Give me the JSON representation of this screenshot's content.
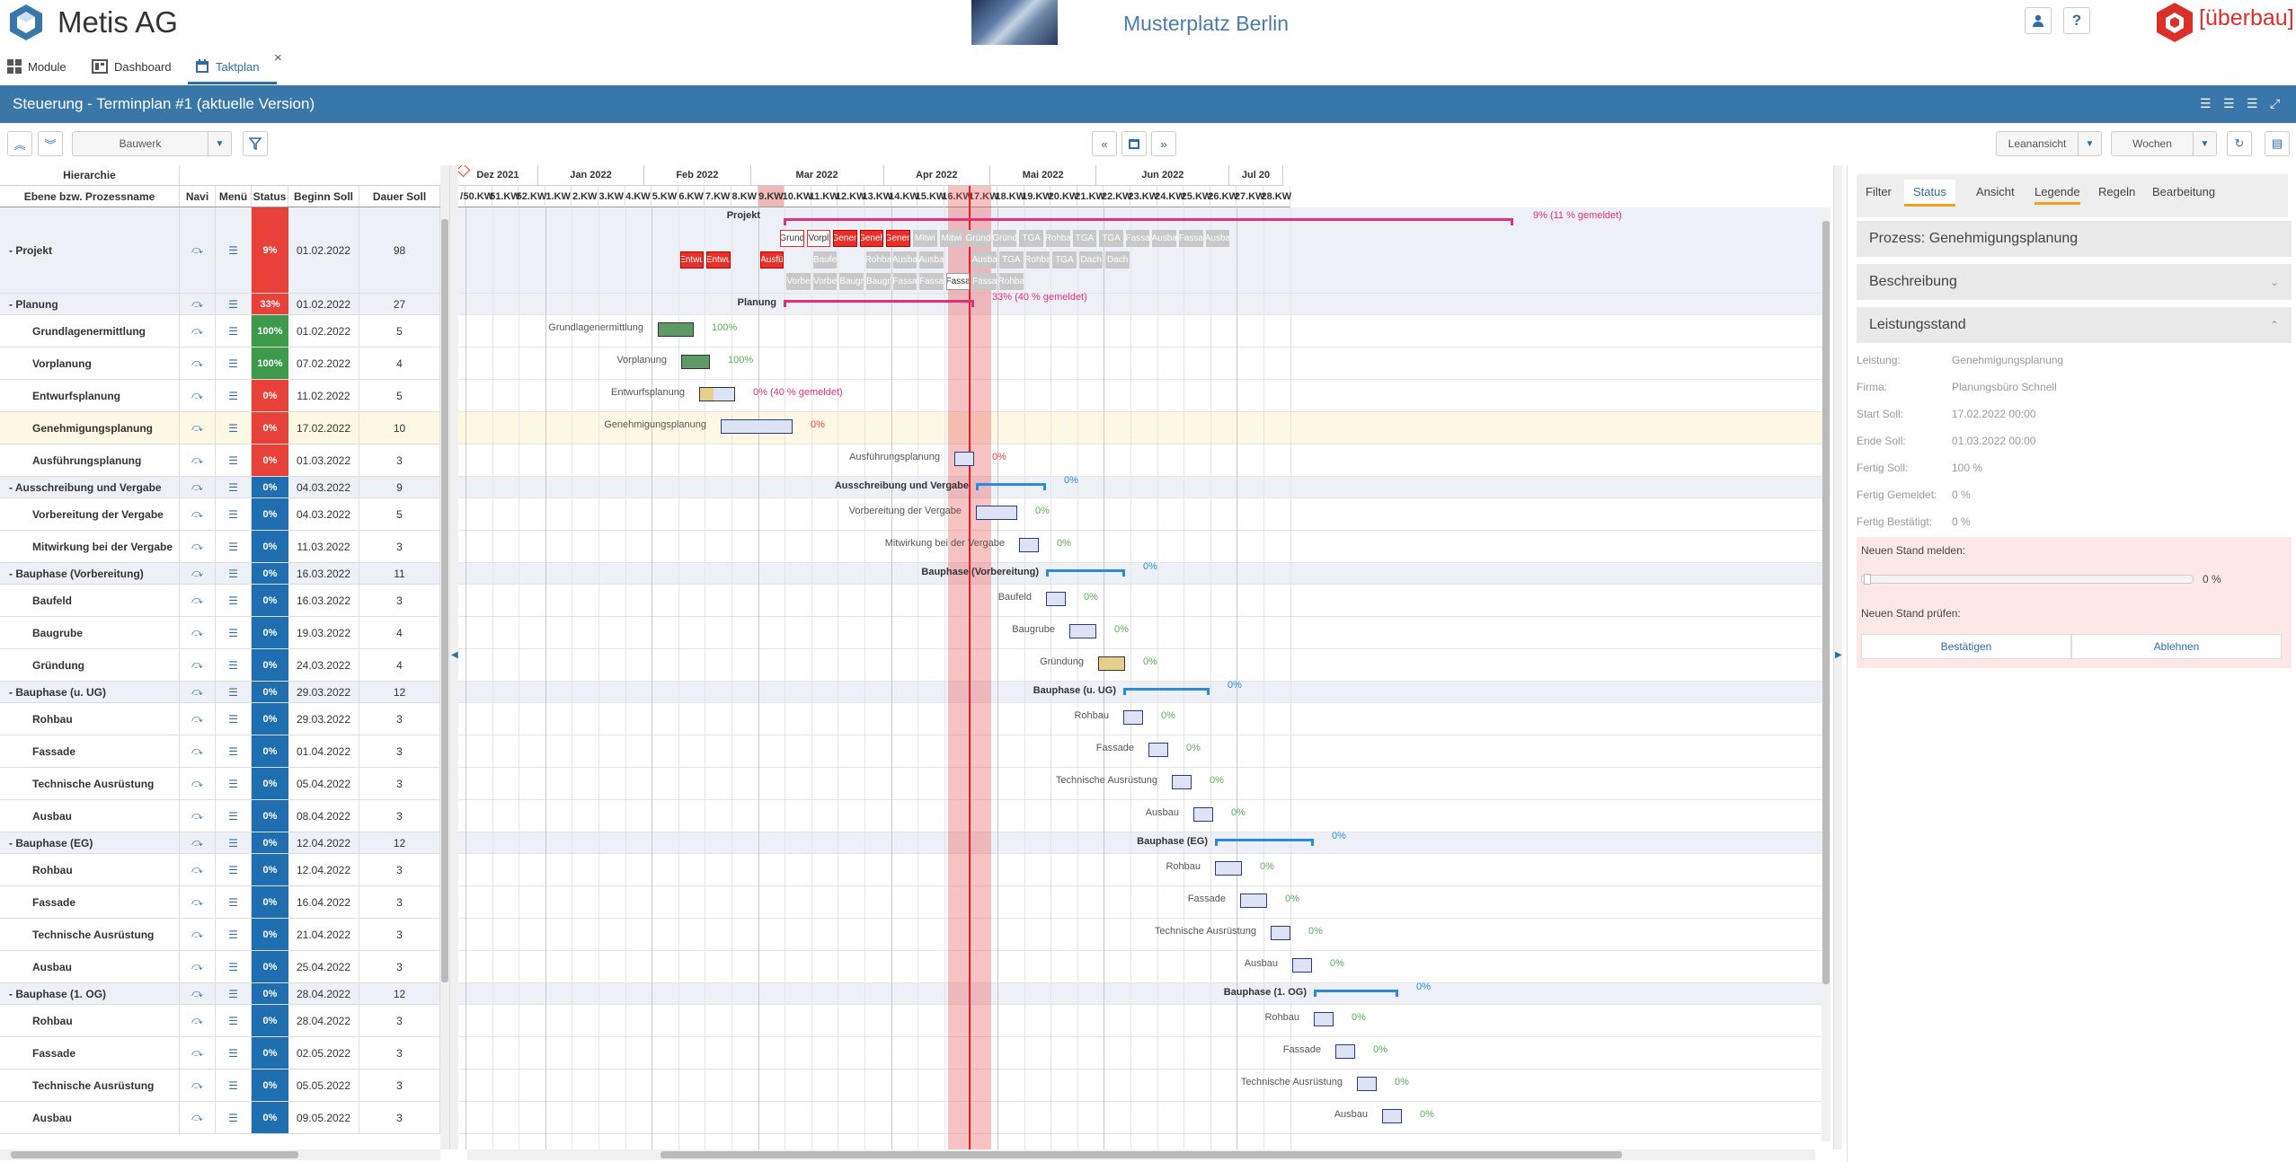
{
  "app": {
    "title": "Metis AG",
    "project": "Musterplatz Berlin",
    "brand": "überbau",
    "brand_bracket": "[überbau]"
  },
  "tabs": [
    {
      "label": "Module"
    },
    {
      "label": "Dashboard"
    },
    {
      "label": "Taktplan",
      "active": true
    }
  ],
  "titlebar": "Steuerung - Terminplan #1 (aktuelle Version)",
  "toolbar": {
    "filter_select": "Bauwerk",
    "view_select": "Leanansicht",
    "unit_select": "Wochen"
  },
  "left": {
    "header_group": "Hierarchie",
    "columns": [
      "Ebene bzw. Prozessname",
      "Navi",
      "Menü",
      "Status",
      "Beginn Soll",
      "Dauer Soll"
    ],
    "rows": [
      {
        "name": "Projekt",
        "prefix": "-",
        "status": "9%",
        "color": "red",
        "start": "01.02.2022",
        "dur": "98",
        "h": 96,
        "sec": true
      },
      {
        "name": "Planung",
        "prefix": "-",
        "status": "33%",
        "color": "red",
        "start": "01.02.2022",
        "dur": "27",
        "h": 24,
        "sec": true
      },
      {
        "name": "Grundlagenermittlung",
        "status": "100%",
        "color": "green",
        "start": "01.02.2022",
        "dur": "5",
        "h": 36
      },
      {
        "name": "Vorplanung",
        "status": "100%",
        "color": "green",
        "start": "07.02.2022",
        "dur": "4",
        "h": 36
      },
      {
        "name": "Entwurfsplanung",
        "status": "0%",
        "color": "red",
        "start": "11.02.2022",
        "dur": "5",
        "h": 36
      },
      {
        "name": "Genehmigungsplanung",
        "status": "0%",
        "color": "red",
        "start": "17.02.2022",
        "dur": "10",
        "h": 36,
        "selected": true
      },
      {
        "name": "Ausführungsplanung",
        "status": "0%",
        "color": "red",
        "start": "01.03.2022",
        "dur": "3",
        "h": 36
      },
      {
        "name": "Ausschreibung und Vergabe",
        "prefix": "-",
        "status": "0%",
        "color": "blue",
        "start": "04.03.2022",
        "dur": "9",
        "h": 24,
        "sec": true
      },
      {
        "name": "Vorbereitung der Vergabe",
        "status": "0%",
        "color": "blue",
        "start": "04.03.2022",
        "dur": "5",
        "h": 36
      },
      {
        "name": "Mitwirkung bei der Vergabe",
        "status": "0%",
        "color": "blue",
        "start": "11.03.2022",
        "dur": "3",
        "h": 36
      },
      {
        "name": "Bauphase (Vorbereitung)",
        "prefix": "-",
        "status": "0%",
        "color": "blue",
        "start": "16.03.2022",
        "dur": "11",
        "h": 24,
        "sec": true
      },
      {
        "name": "Baufeld",
        "status": "0%",
        "color": "blue",
        "start": "16.03.2022",
        "dur": "3",
        "h": 36
      },
      {
        "name": "Baugrube",
        "status": "0%",
        "color": "blue",
        "start": "19.03.2022",
        "dur": "4",
        "h": 36
      },
      {
        "name": "Gründung",
        "status": "0%",
        "color": "blue",
        "start": "24.03.2022",
        "dur": "4",
        "h": 36
      },
      {
        "name": "Bauphase (u. UG)",
        "prefix": "-",
        "status": "0%",
        "color": "blue",
        "start": "29.03.2022",
        "dur": "12",
        "h": 24,
        "sec": true
      },
      {
        "name": "Rohbau",
        "status": "0%",
        "color": "blue",
        "start": "29.03.2022",
        "dur": "3",
        "h": 36
      },
      {
        "name": "Fassade",
        "status": "0%",
        "color": "blue",
        "start": "01.04.2022",
        "dur": "3",
        "h": 36
      },
      {
        "name": "Technische Ausrüstung",
        "status": "0%",
        "color": "blue",
        "start": "05.04.2022",
        "dur": "3",
        "h": 36
      },
      {
        "name": "Ausbau",
        "status": "0%",
        "color": "blue",
        "start": "08.04.2022",
        "dur": "3",
        "h": 36
      },
      {
        "name": "Bauphase (EG)",
        "prefix": "-",
        "status": "0%",
        "color": "blue",
        "start": "12.04.2022",
        "dur": "12",
        "h": 24,
        "sec": true
      },
      {
        "name": "Rohbau",
        "status": "0%",
        "color": "blue",
        "start": "12.04.2022",
        "dur": "3",
        "h": 36
      },
      {
        "name": "Fassade",
        "status": "0%",
        "color": "blue",
        "start": "16.04.2022",
        "dur": "3",
        "h": 36
      },
      {
        "name": "Technische Ausrüstung",
        "status": "0%",
        "color": "blue",
        "start": "21.04.2022",
        "dur": "3",
        "h": 36
      },
      {
        "name": "Ausbau",
        "status": "0%",
        "color": "blue",
        "start": "25.04.2022",
        "dur": "3",
        "h": 36
      },
      {
        "name": "Bauphase (1. OG)",
        "prefix": "-",
        "status": "0%",
        "color": "blue",
        "start": "28.04.2022",
        "dur": "12",
        "h": 24,
        "sec": true
      },
      {
        "name": "Rohbau",
        "status": "0%",
        "color": "blue",
        "start": "28.04.2022",
        "dur": "3",
        "h": 36
      },
      {
        "name": "Fassade",
        "status": "0%",
        "color": "blue",
        "start": "02.05.2022",
        "dur": "3",
        "h": 36
      },
      {
        "name": "Technische Ausrüstung",
        "status": "0%",
        "color": "blue",
        "start": "05.05.2022",
        "dur": "3",
        "h": 36
      },
      {
        "name": "Ausbau",
        "status": "0%",
        "color": "blue",
        "start": "09.05.2022",
        "dur": "3",
        "h": 36
      }
    ]
  },
  "gantt": {
    "months": [
      {
        "label": "Dez 2021",
        "w": 3
      },
      {
        "label": "Jan 2022",
        "w": 4
      },
      {
        "label": "Feb 2022",
        "w": 4
      },
      {
        "label": "Mar 2022",
        "w": 5
      },
      {
        "label": "Apr 2022",
        "w": 4
      },
      {
        "label": "Mai 2022",
        "w": 4
      },
      {
        "label": "Jun 2022",
        "w": 5
      },
      {
        "label": "Jul 20",
        "w": 2
      }
    ],
    "weeks": [
      "/",
      "50.KW",
      "51.KW",
      "52.KW",
      "1.KW",
      "2.KW",
      "3.KW",
      "4.KW",
      "5.KW",
      "6.KW",
      "7.KW",
      "8.KW",
      "9.KW",
      "10.KW",
      "11.KW",
      "12.KW",
      "13.KW",
      "14.KW",
      "15.KW",
      "16.KW",
      "17.KW",
      "18.KW",
      "19.KW",
      "20.KW",
      "21.KW",
      "22.KW",
      "23.KW",
      "24.KW",
      "25.KW",
      "26.KW",
      "27.KW",
      "28.KW"
    ],
    "current_week": "9.KW",
    "labels": [
      "Projekt",
      "Planung",
      "Grundlagenermittlung",
      "Vorplanung",
      "Entwurfsplanung",
      "Genehmigungsplanung",
      "Ausführungsplanung",
      "Ausschreibung und Vergabe",
      "Vorbereitung der Vergabe",
      "Mitwirkung bei der Vergabe",
      "Bauphase (Vorbereitung)",
      "Baufeld",
      "Baugrube",
      "Gründung",
      "Bauphase (u. UG)",
      "Rohbau",
      "Fassade",
      "Technische Ausrüstung",
      "Ausbau",
      "Bauphase (EG)",
      "Rohbau",
      "Fassade",
      "Technische Ausrüstung",
      "Ausbau",
      "Bauphase (1. OG)",
      "Rohbau",
      "Fassade",
      "Technische Ausrüstung",
      "Ausbau"
    ],
    "pcts": [
      "9% (11 % gemeldet)",
      "33% (40 % gemeldet)",
      "100%",
      "100%",
      "0% (40 % gemeldet)",
      "0%",
      "0%",
      "0%",
      "0%",
      "0%",
      "0%",
      "0%",
      "0%",
      "0%",
      "0%",
      "0%",
      "0%",
      "0%",
      "0%",
      "0%",
      "0%",
      "0%",
      "0%",
      "0%",
      "0%",
      "0%",
      "0%",
      "0%",
      "0%"
    ],
    "chips_row1": [
      {
        "t": "Grund",
        "c": "wh"
      },
      {
        "t": "Vorpl",
        "c": "wh"
      },
      {
        "t": "Genen",
        "c": "rd"
      },
      {
        "t": "Geneh",
        "c": "rd"
      },
      {
        "t": "Genen",
        "c": "rd"
      },
      {
        "t": "Mitwi",
        "c": "gr"
      },
      {
        "t": "Mitwi",
        "c": "gr"
      },
      {
        "t": "Gründ",
        "c": "gr"
      },
      {
        "t": "Gründ",
        "c": "gr"
      },
      {
        "t": "TGA",
        "c": "gr"
      },
      {
        "t": "Rohba",
        "c": "gr"
      },
      {
        "t": "TGA",
        "c": "gr"
      },
      {
        "t": "TGA",
        "c": "gr"
      },
      {
        "t": "Fassa",
        "c": "gr"
      },
      {
        "t": "Ausba",
        "c": "gr"
      },
      {
        "t": "Fassa",
        "c": "gr"
      },
      {
        "t": "Ausba",
        "c": "gr"
      }
    ],
    "chips_row2": [
      {
        "t": "Entwu",
        "c": "rd",
        "k": 9
      },
      {
        "t": "Entwu",
        "c": "rd",
        "k": 10
      },
      {
        "t": "Ausfü",
        "c": "rd",
        "k": 12
      },
      {
        "t": "Baufe",
        "c": "gr",
        "k": 14
      },
      {
        "t": "Rohba",
        "c": "gr",
        "k": 16
      },
      {
        "t": "Ausba",
        "c": "gr",
        "k": 17
      },
      {
        "t": "Ausba",
        "c": "gr",
        "k": 18
      },
      {
        "t": "Ausba",
        "c": "gr",
        "k": 20
      },
      {
        "t": "TGA",
        "c": "gr",
        "k": 21
      },
      {
        "t": "Rohba",
        "c": "gr",
        "k": 22
      },
      {
        "t": "TGA",
        "c": "gr",
        "k": 23
      },
      {
        "t": "Dach",
        "c": "gr",
        "k": 24
      },
      {
        "t": "Dach",
        "c": "gr",
        "k": 25
      }
    ],
    "chips_row3": [
      {
        "t": "Vorbe",
        "c": "gr",
        "k": 12
      },
      {
        "t": "Vorbe",
        "c": "gr",
        "k": 13
      },
      {
        "t": "Baugr",
        "c": "gr",
        "k": 14
      },
      {
        "t": "Baugr",
        "c": "gr",
        "k": 15
      },
      {
        "t": "Fassa",
        "c": "gr",
        "k": 16
      },
      {
        "t": "Fassa",
        "c": "gr",
        "k": 17
      },
      {
        "t": "Fassa",
        "c": "wb",
        "k": 18
      },
      {
        "t": "Fassa",
        "c": "gr",
        "k": 19
      },
      {
        "t": "Rohba",
        "c": "gr",
        "k": 20
      }
    ]
  },
  "right": {
    "tabs": [
      "Filter",
      "Status",
      "Ansicht",
      "Legende",
      "Regeln",
      "Bearbeitung"
    ],
    "active_tab": "Status",
    "process_title": "Prozess: Genehmigungsplanung",
    "section_desc": "Beschreibung",
    "section_perf": "Leistungsstand",
    "fields": [
      {
        "k": "Leistung:",
        "v": "Genehmigungsplanung"
      },
      {
        "k": "Firma:",
        "v": "Planungsbüro Schnell"
      },
      {
        "k": "Start Soll:",
        "v": "17.02.2022 00:00"
      },
      {
        "k": "Ende Soll:",
        "v": "01.03.2022 00:00"
      },
      {
        "k": "Fertig Soll:",
        "v": "100 %"
      },
      {
        "k": "Fertig Gemeldet:",
        "v": "0 %"
      },
      {
        "k": "Fertig Bestätigt:",
        "v": "0 %"
      }
    ],
    "report_label": "Neuen Stand melden:",
    "slider_value": "0 %",
    "check_label": "Neuen Stand prüfen:",
    "confirm": "Bestätigen",
    "reject": "Ablehnen"
  }
}
